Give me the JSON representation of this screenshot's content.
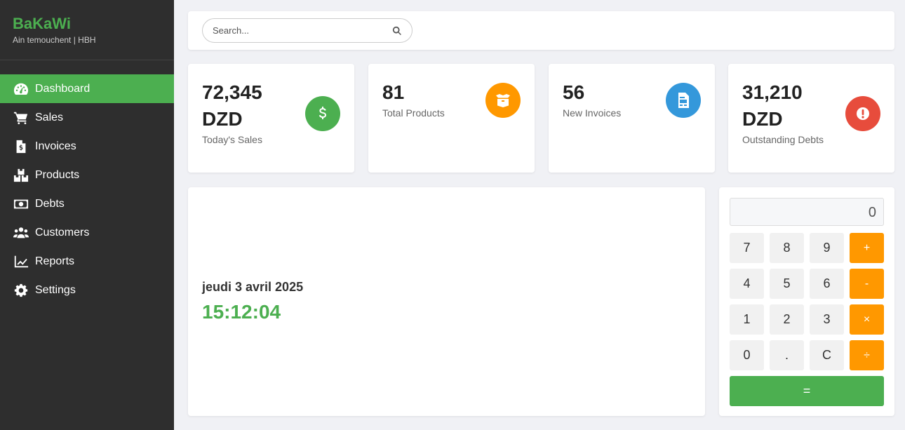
{
  "brand": {
    "name": "BaKaWi",
    "subtitle": "Ain temouchent | HBH"
  },
  "nav": [
    {
      "label": "Dashboard",
      "icon": "dashboard-gauge-icon",
      "active": true
    },
    {
      "label": "Sales",
      "icon": "shopping-cart-icon"
    },
    {
      "label": "Invoices",
      "icon": "invoice-icon"
    },
    {
      "label": "Products",
      "icon": "boxes-icon"
    },
    {
      "label": "Debts",
      "icon": "money-bill-icon"
    },
    {
      "label": "Customers",
      "icon": "users-icon"
    },
    {
      "label": "Reports",
      "icon": "line-chart-icon"
    },
    {
      "label": "Settings",
      "icon": "gear-icon"
    }
  ],
  "search": {
    "placeholder": "Search..."
  },
  "stats": [
    {
      "value": "72,345 DZD",
      "label": "Today's Sales",
      "icon": "dollar-icon",
      "color": "#4caf50"
    },
    {
      "value": "81",
      "label": "Total Products",
      "icon": "box-open-icon",
      "color": "#ff9800"
    },
    {
      "value": "56",
      "label": "New Invoices",
      "icon": "file-invoice-icon",
      "color": "#3498db"
    },
    {
      "value": "31,210 DZD",
      "label": "Outstanding Debts",
      "icon": "exclamation-icon",
      "color": "#e74c3c"
    }
  ],
  "clock": {
    "date": "jeudi 3 avril 2025",
    "time": "15:12:04"
  },
  "calculator": {
    "display": "0",
    "keys": [
      "7",
      "8",
      "9",
      "+",
      "4",
      "5",
      "6",
      "-",
      "1",
      "2",
      "3",
      "×",
      "0",
      ".",
      "C",
      "÷"
    ],
    "equals": "="
  },
  "colors": {
    "accent": "#4caf50",
    "sidebar": "#2e2e2e",
    "operator": "#ff9800"
  }
}
